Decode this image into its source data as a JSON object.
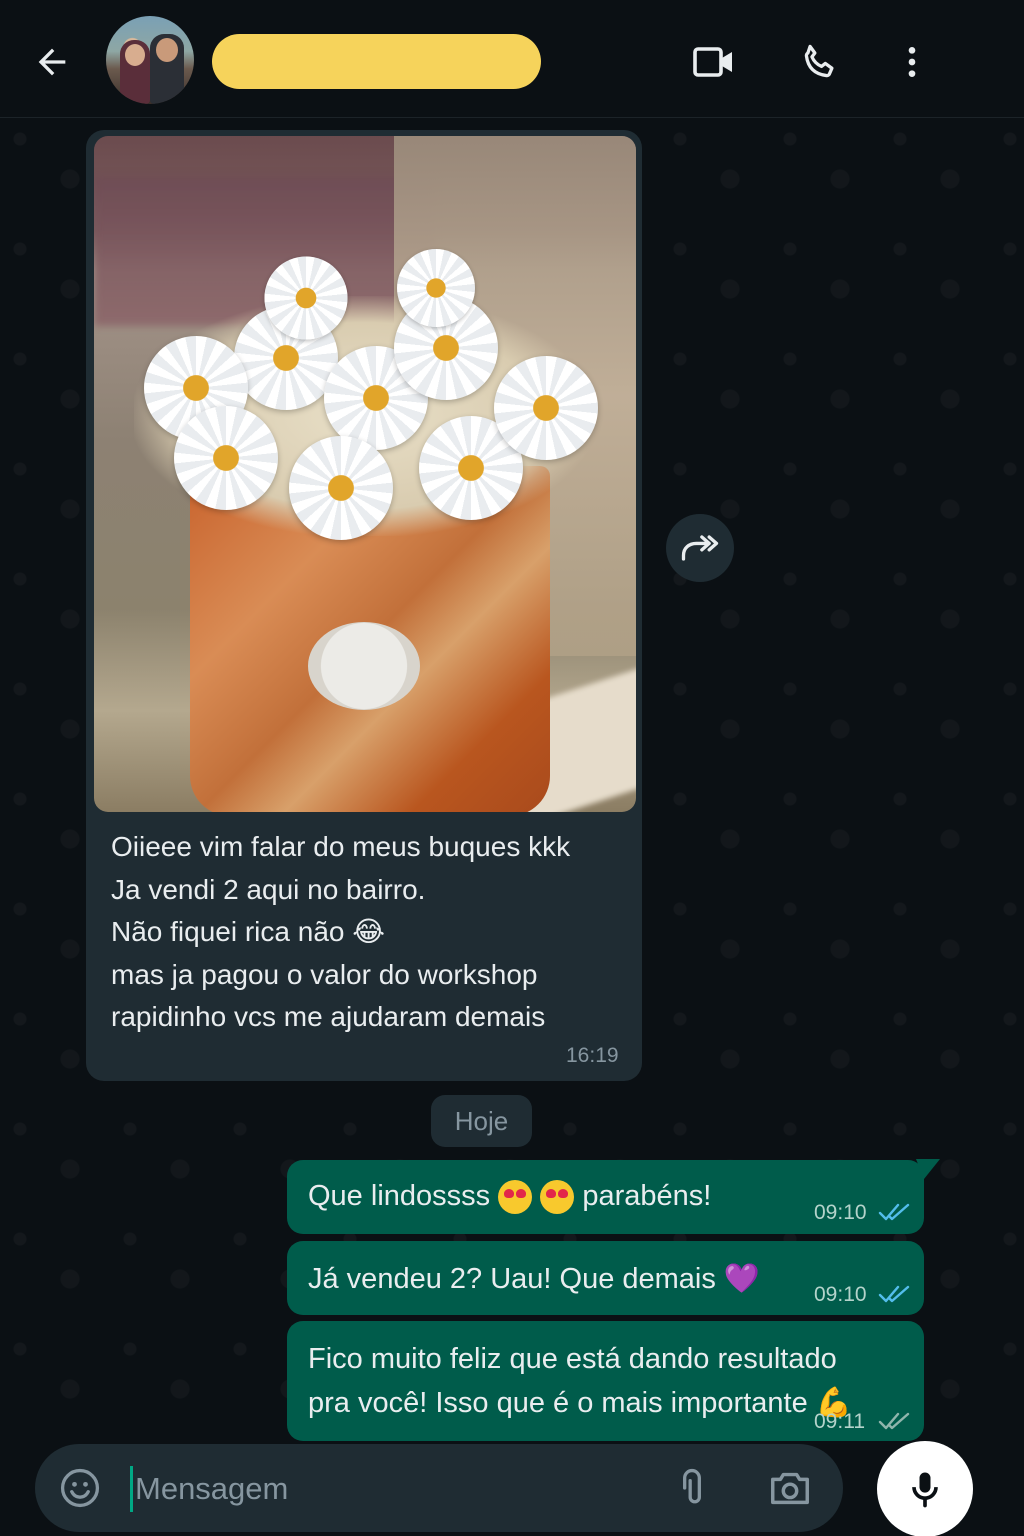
{
  "header": {
    "back_icon": "arrow-left-icon",
    "contact_name": "",
    "video_icon": "video-camera-icon",
    "call_icon": "phone-icon",
    "menu_icon": "more-vertical-icon",
    "name_highlight_color": "#f6d35b"
  },
  "messages": {
    "incoming": {
      "has_photo": true,
      "text": "Oiieee vim falar do meus buques kkk\nJa vendi 2 aqui no bairro.\nNão fiquei rica não 😂\nmas ja pagou o valor do workshop\nrapidinho vcs me ajudaram demais",
      "time": "16:19",
      "forward_icon": "forward-icon"
    },
    "date_divider": "Hoje",
    "outgoing": [
      {
        "text_a": "Que lindossss",
        "text_b": "parabéns!",
        "time": "09:10",
        "status": "read"
      },
      {
        "text": "Já vendeu 2? Uau! Que demais 💜",
        "time": "09:10",
        "status": "read"
      },
      {
        "text": "Fico muito feliz que está dando resultado\npra você! Isso que é o mais importante 💪",
        "time": "09:11",
        "status": "sent"
      }
    ]
  },
  "composer": {
    "placeholder": "Mensagem",
    "emoji_icon": "emoji-icon",
    "attach_icon": "paperclip-icon",
    "camera_icon": "camera-icon",
    "mic_icon": "microphone-icon"
  },
  "colors": {
    "background": "#0b1014",
    "incoming_bubble": "#1f2c33",
    "outgoing_bubble": "#005c4b",
    "read_tick": "#53bdeb",
    "sent_tick": "#8fb5ac"
  }
}
